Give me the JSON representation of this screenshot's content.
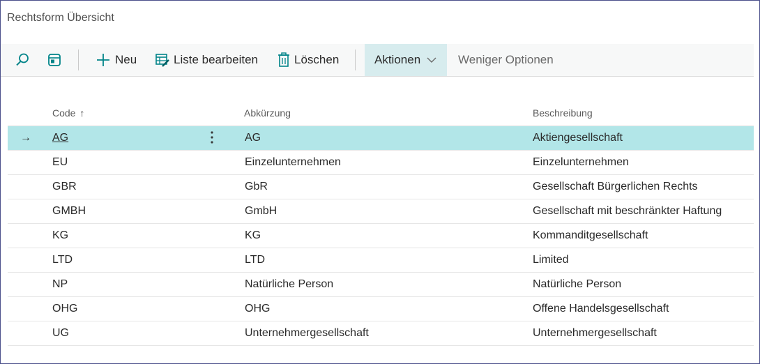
{
  "page": {
    "title": "Rechtsform Übersicht"
  },
  "toolbar": {
    "new_label": "Neu",
    "edit_list_label": "Liste bearbeiten",
    "delete_label": "Löschen",
    "actions_label": "Aktionen",
    "fewer_options_label": "Weniger Optionen"
  },
  "columns": {
    "code": "Code",
    "sort_indicator": "↑",
    "abbreviation": "Abkürzung",
    "description": "Beschreibung"
  },
  "selected_marker": "→",
  "rows": [
    {
      "code": "AG",
      "abk": "AG",
      "bes": "Aktiengesellschaft"
    },
    {
      "code": "EU",
      "abk": "Einzelunternehmen",
      "bes": "Einzelunternehmen"
    },
    {
      "code": "GBR",
      "abk": "GbR",
      "bes": "Gesellschaft Bürgerlichen Rechts"
    },
    {
      "code": "GMBH",
      "abk": "GmbH",
      "bes": "Gesellschaft mit beschränkter Haftung"
    },
    {
      "code": "KG",
      "abk": "KG",
      "bes": "Kommanditgesellschaft"
    },
    {
      "code": "LTD",
      "abk": "LTD",
      "bes": "Limited"
    },
    {
      "code": "NP",
      "abk": "Natürliche Person",
      "bes": "Natürliche Person"
    },
    {
      "code": "OHG",
      "abk": "OHG",
      "bes": "Offene Handelsgesellschaft"
    },
    {
      "code": "UG",
      "abk": "Unternehmergesellschaft",
      "bes": "Unternehmergesellschaft"
    }
  ],
  "colors": {
    "accent": "#008489",
    "selected_row": "#b2e6e8",
    "actions_bg": "#d7ecee"
  },
  "icons": [
    "search-icon",
    "layout-icon",
    "plus-icon",
    "edit-list-icon",
    "trash-icon",
    "chevron-down-icon",
    "row-arrow-icon",
    "more-options-icon"
  ]
}
